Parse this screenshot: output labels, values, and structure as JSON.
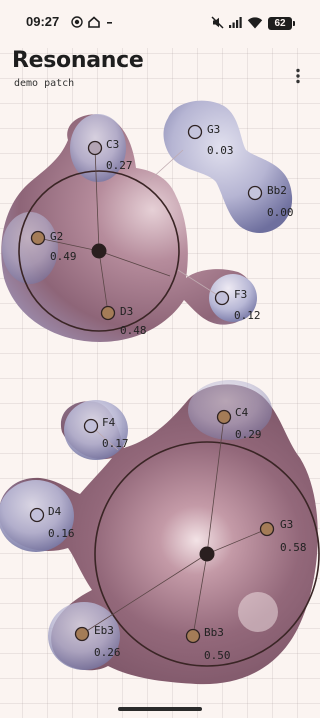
{
  "status_bar": {
    "time": "09:27",
    "battery": "62",
    "icons": [
      "signal-app-icon",
      "home-app-icon",
      "dash-icon",
      "mute-icon",
      "cell-signal-icon",
      "wifi-icon",
      "battery-icon"
    ]
  },
  "header": {
    "title": "Resonance",
    "subtitle": "demo patch",
    "menu_icon": "more-vert-icon"
  },
  "colors": {
    "background": "#fbf4f1",
    "grid": "#d8d0cd",
    "blob_light": "#b8b9d7",
    "blob_dark": "#85596d",
    "rose": "#b98a98",
    "node_ring": "#3b2b2b",
    "node_brown": "#a47c57",
    "center": "#2a1f1f"
  },
  "clusters": [
    {
      "name": "upper-cluster",
      "nodes": [
        {
          "label": "C3",
          "value": "0.27",
          "filled": false
        },
        {
          "label": "G2",
          "value": "0.49",
          "filled": true
        },
        {
          "label": "D3",
          "value": "0.48",
          "filled": true
        },
        {
          "label": "F3",
          "value": "0.12",
          "filled": false
        }
      ]
    },
    {
      "name": "pair-cluster",
      "nodes": [
        {
          "label": "G3",
          "value": "0.03",
          "filled": false
        },
        {
          "label": "Bb2",
          "value": "0.00",
          "filled": false
        }
      ]
    },
    {
      "name": "lower-cluster",
      "nodes": [
        {
          "label": "F4",
          "value": "0.17",
          "filled": false
        },
        {
          "label": "C4",
          "value": "0.29",
          "filled": true
        },
        {
          "label": "D4",
          "value": "0.16",
          "filled": false
        },
        {
          "label": "G3",
          "value": "0.58",
          "filled": true
        },
        {
          "label": "Eb3",
          "value": "0.26",
          "filled": true
        },
        {
          "label": "Bb3",
          "value": "0.50",
          "filled": true
        }
      ]
    }
  ]
}
